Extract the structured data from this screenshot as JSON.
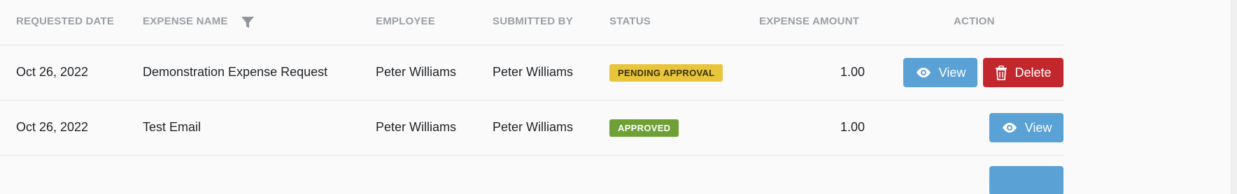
{
  "table": {
    "headers": {
      "requested_date": "REQUESTED DATE",
      "expense_name": "EXPENSE NAME",
      "employee": "EMPLOYEE",
      "submitted_by": "SUBMITTED BY",
      "status": "STATUS",
      "expense_amount": "EXPENSE AMOUNT",
      "action": "ACTION"
    },
    "rows": [
      {
        "requested_date": "Oct 26, 2022",
        "expense_name": "Demonstration Expense Request",
        "employee": "Peter Williams",
        "submitted_by": "Peter Williams",
        "status": "PENDING APPROVAL",
        "amount": "1.00",
        "view_label": "View",
        "delete_label": "Delete"
      },
      {
        "requested_date": "Oct 26, 2022",
        "expense_name": "Test Email",
        "employee": "Peter Williams",
        "submitted_by": "Peter Williams",
        "status": "APPROVED",
        "amount": "1.00",
        "view_label": "View"
      }
    ]
  },
  "icons": {
    "filter": "filter-icon",
    "view": "eye-icon",
    "delete": "trash-icon"
  },
  "colors": {
    "pending_badge": "#e8c53a",
    "approved_badge": "#6da035",
    "view_button": "#5aa1d6",
    "delete_button": "#c1272d",
    "header_text": "#9aa0a6"
  }
}
